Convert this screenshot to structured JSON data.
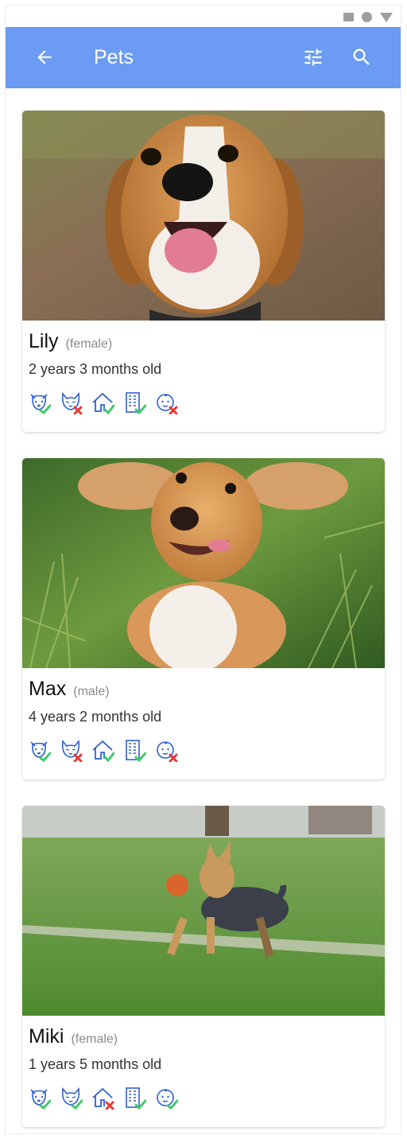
{
  "header": {
    "title": "Pets",
    "back_icon": "arrow-back-icon",
    "filter_icon": "tune-icon",
    "search_icon": "search-icon"
  },
  "colors": {
    "app_bar": "#6b9bf2",
    "icon_blue": "#2f5fd6",
    "ok": "#43c96b",
    "no": "#e53935"
  },
  "pets": [
    {
      "name": "Lily",
      "sex": "(female)",
      "age": "2 years 3 months old",
      "photo": "beagle-dog-photo",
      "traits": [
        {
          "icon": "dog-friendly-icon",
          "status": "ok"
        },
        {
          "icon": "cat-friendly-icon",
          "status": "no"
        },
        {
          "icon": "house-icon",
          "status": "ok"
        },
        {
          "icon": "apartment-icon",
          "status": "ok"
        },
        {
          "icon": "child-friendly-icon",
          "status": "no"
        }
      ]
    },
    {
      "name": "Max",
      "sex": "(male)",
      "age": "4 years 2 months old",
      "photo": "spaniel-dog-photo",
      "traits": [
        {
          "icon": "dog-friendly-icon",
          "status": "ok"
        },
        {
          "icon": "cat-friendly-icon",
          "status": "no"
        },
        {
          "icon": "house-icon",
          "status": "ok"
        },
        {
          "icon": "apartment-icon",
          "status": "ok"
        },
        {
          "icon": "child-friendly-icon",
          "status": "no"
        }
      ]
    },
    {
      "name": "Miki",
      "sex": "(female)",
      "age": "1 years 5 months old",
      "photo": "yorkshire-terrier-photo",
      "traits": [
        {
          "icon": "dog-friendly-icon",
          "status": "ok"
        },
        {
          "icon": "cat-friendly-icon",
          "status": "ok"
        },
        {
          "icon": "house-icon",
          "status": "no"
        },
        {
          "icon": "apartment-icon",
          "status": "ok"
        },
        {
          "icon": "child-friendly-icon",
          "status": "ok"
        }
      ]
    }
  ]
}
